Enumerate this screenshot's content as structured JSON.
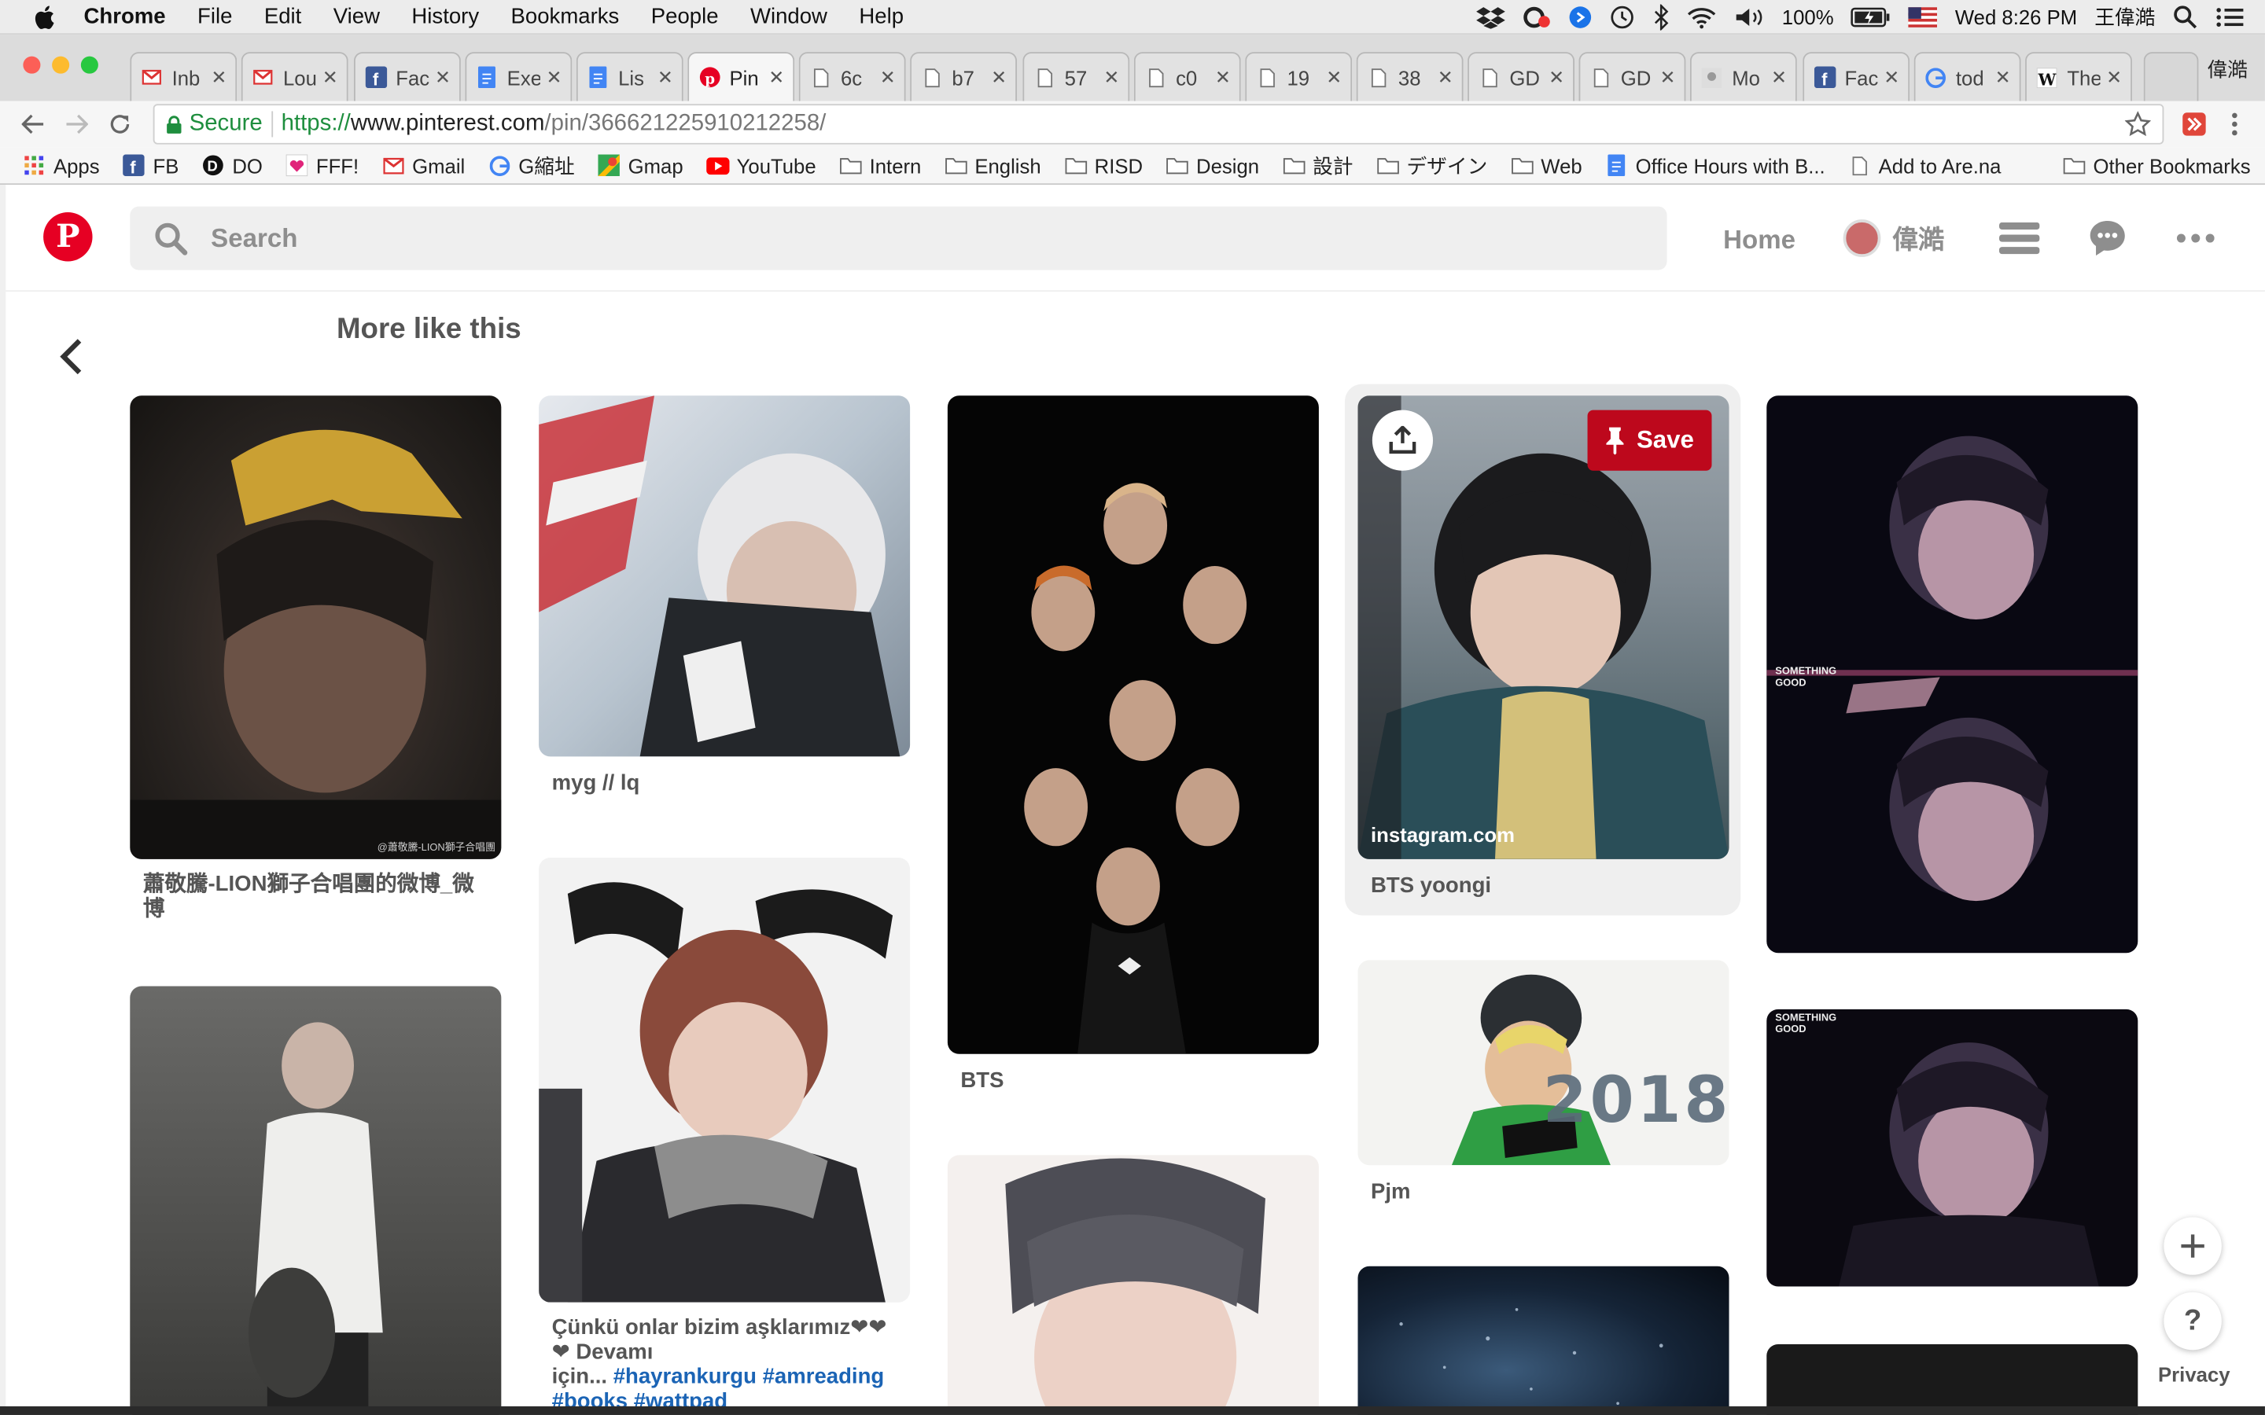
{
  "menubar": {
    "app": "Chrome",
    "items": [
      "File",
      "Edit",
      "View",
      "History",
      "Bookmarks",
      "People",
      "Window",
      "Help"
    ],
    "battery": "100%",
    "clock": "Wed 8:26 PM",
    "user": "王偉澔"
  },
  "tabs": [
    {
      "icon": "gmail-icon",
      "label": "Inb"
    },
    {
      "icon": "gmail-icon",
      "label": "Lou"
    },
    {
      "icon": "facebook-icon",
      "label": "Fac"
    },
    {
      "icon": "docs-icon",
      "label": "Exe"
    },
    {
      "icon": "docs-icon",
      "label": "Lis"
    },
    {
      "icon": "pinterest-icon",
      "label": "Pin"
    },
    {
      "icon": "page-icon",
      "label": "6c"
    },
    {
      "icon": "page-icon",
      "label": "b7"
    },
    {
      "icon": "page-icon",
      "label": "57"
    },
    {
      "icon": "page-icon",
      "label": "c0"
    },
    {
      "icon": "page-icon",
      "label": "19"
    },
    {
      "icon": "page-icon",
      "label": "38"
    },
    {
      "icon": "page-icon",
      "label": "GD"
    },
    {
      "icon": "page-icon",
      "label": "GD"
    },
    {
      "icon": "image-icon",
      "label": "Mo"
    },
    {
      "icon": "facebook-icon",
      "label": "Fac"
    },
    {
      "icon": "google-icon",
      "label": "tod"
    },
    {
      "icon": "wikipedia-icon",
      "label": "The"
    }
  ],
  "profile_name": "偉澔",
  "address": {
    "secure_label": "Secure",
    "scheme": "https://",
    "host": "www.pinterest.com",
    "path": "/pin/366621225910212258/"
  },
  "bookmarks": [
    {
      "icon": "apps-icon",
      "label": "Apps"
    },
    {
      "icon": "facebook-icon",
      "label": "FB"
    },
    {
      "icon": "do-icon",
      "label": "DO"
    },
    {
      "icon": "heart-icon",
      "label": "FFF!"
    },
    {
      "icon": "gmail-icon",
      "label": "Gmail"
    },
    {
      "icon": "google-icon",
      "label": "G縮址"
    },
    {
      "icon": "maps-icon",
      "label": "Gmap"
    },
    {
      "icon": "youtube-icon",
      "label": "YouTube"
    },
    {
      "icon": "folder-icon",
      "label": "Intern"
    },
    {
      "icon": "folder-icon",
      "label": "English"
    },
    {
      "icon": "folder-icon",
      "label": "RISD"
    },
    {
      "icon": "folder-icon",
      "label": "Design"
    },
    {
      "icon": "folder-icon",
      "label": "設計"
    },
    {
      "icon": "folder-icon",
      "label": "デザイン"
    },
    {
      "icon": "folder-icon",
      "label": "Web"
    },
    {
      "icon": "docs-icon",
      "label": "Office Hours with B..."
    },
    {
      "icon": "page-icon",
      "label": "Add to Are.na"
    }
  ],
  "other_bookmarks": "Other Bookmarks",
  "pinterest": {
    "search_placeholder": "Search",
    "nav_home": "Home",
    "user_name": "偉澔",
    "section_title": "More like this",
    "save_label": "Save",
    "privacy_label": "Privacy",
    "pins": [
      {
        "title": "蕭敬騰-LION獅子合唱團的微博_微博",
        "watermark": "@蕭敬騰-LION獅子合唱團"
      },
      {
        "title": ""
      },
      {
        "title": "myg // lq"
      },
      {
        "title": "Çünkü onlar bizim aşklarımız❤❤ ❤ Devamı",
        "title2": "için...",
        "tags": [
          "#hayrankurgu",
          "#amreading",
          "#books",
          "#wattpad"
        ]
      },
      {
        "title": "BTS"
      },
      {
        "title": ""
      },
      {
        "title": "BTS yoongi",
        "domain": "instagram.com"
      },
      {
        "title": "Pjm",
        "overlay": "2018"
      },
      {
        "title": ""
      },
      {
        "title": "",
        "overlay": "SOMETHING GOOD"
      },
      {
        "title": "",
        "overlay": "SOMETHING GOOD"
      },
      {
        "title": ""
      }
    ]
  },
  "colors": {
    "brand": "#e60023",
    "save": "#bd081c",
    "link": "#1b64b5"
  }
}
